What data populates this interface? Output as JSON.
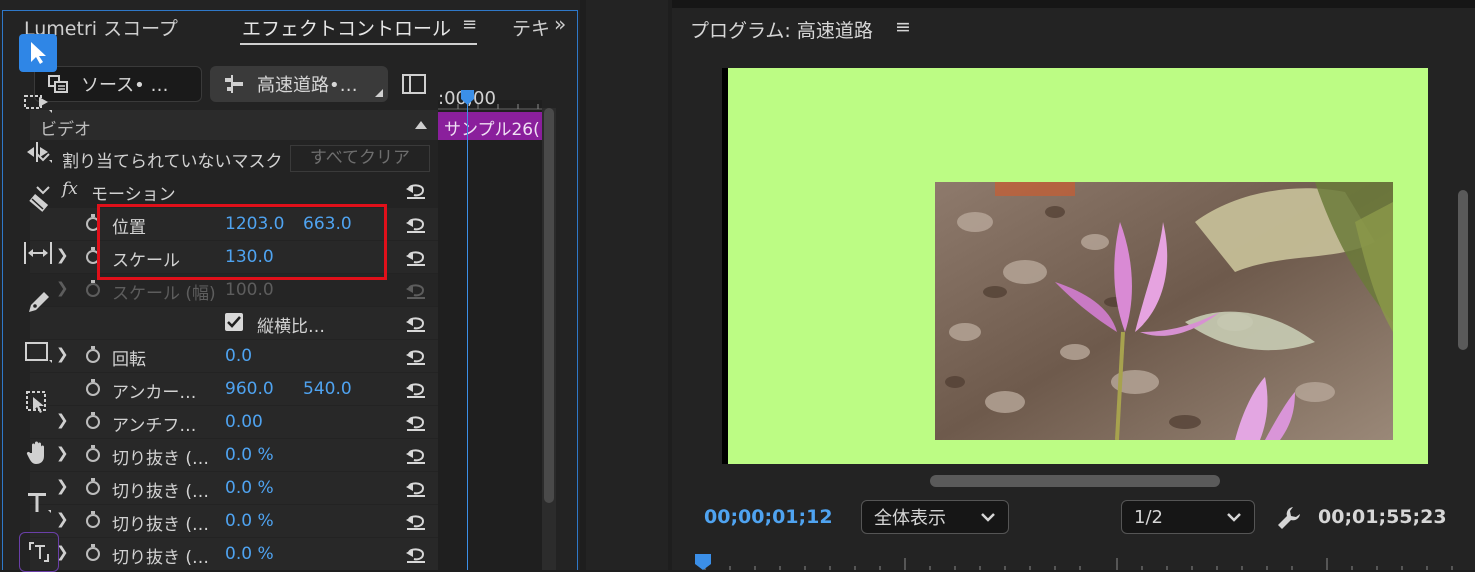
{
  "effect_controls": {
    "tabs": [
      {
        "label": "Lumetri スコープ"
      },
      {
        "label": "エフェクトコントロール"
      },
      {
        "label": "テキ"
      }
    ],
    "menu_icon": "≡",
    "overflow": "»",
    "source_chip": "ソース• …",
    "sequence_chip": "高速道路•…",
    "timeline_time": ":00;00",
    "clip_label": "サンプル26(",
    "section_video": "ビデオ",
    "mask_row": {
      "label": "割り当てられていないマスク",
      "clear_button": "すべてクリア"
    },
    "motion": {
      "fx": "fx",
      "label": "モーション"
    },
    "properties": [
      {
        "label": "位置",
        "value1": "1203.0",
        "value2": "663.0"
      },
      {
        "label": "スケール",
        "value1": "130.0"
      },
      {
        "label": "スケール (幅)",
        "value1": "100.0"
      },
      {
        "label": "縦横比…"
      },
      {
        "label": "回転",
        "value1": "0.0"
      },
      {
        "label": "アンカー…",
        "value1": "960.0",
        "value2": "540.0"
      },
      {
        "label": "アンチフ…",
        "value1": "0.00"
      },
      {
        "label": "切り抜き (…",
        "value1": "0.0 %"
      },
      {
        "label": "切り抜き (…",
        "value1": "0.0 %"
      },
      {
        "label": "切り抜き (…",
        "value1": "0.0 %"
      },
      {
        "label": "切り抜き (…",
        "value1": "0.0 %"
      }
    ]
  },
  "tools": [
    "selection-tool",
    "track-select-tool",
    "ripple-edit-tool",
    "razor-tool",
    "slip-tool",
    "pen-tool",
    "rectangle-tool",
    "remix-tool",
    "hand-tool",
    "type-tool",
    "caption-tool"
  ],
  "program": {
    "title": "プログラム: 高速道路",
    "menu_icon": "≡",
    "current_time": "00;00;01;12",
    "zoom": "全体表示",
    "resolution": "1/2",
    "duration": "00;01;55;23"
  },
  "colors": {
    "accent_blue": "#4fa3f0",
    "canvas_green": "#bcfc84",
    "highlight_red": "#e0101a",
    "clip_purple": "#8a1f9c"
  }
}
